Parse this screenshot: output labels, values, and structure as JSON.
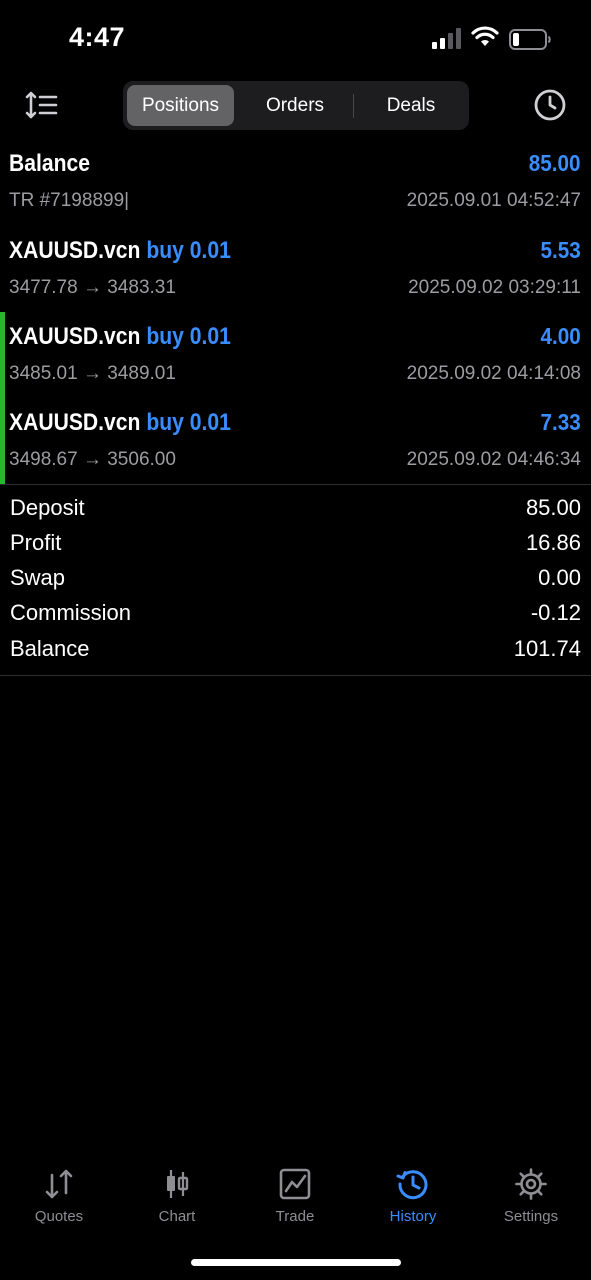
{
  "status_bar": {
    "time": "4:47"
  },
  "segments": [
    {
      "label": "Positions",
      "active": true
    },
    {
      "label": "Orders",
      "active": false
    },
    {
      "label": "Deals",
      "active": false
    }
  ],
  "balance_row": {
    "title": "Balance",
    "amount": "85.00",
    "sub": "TR #7198899|",
    "time": "2025.09.01 04:52:47"
  },
  "deals": [
    {
      "symbol": "XAUUSD.vcn",
      "side": "buy 0.01",
      "profit": "5.53",
      "prices": "3477.78 → 3483.31",
      "time": "2025.09.02 03:29:11"
    },
    {
      "symbol": "XAUUSD.vcn",
      "side": "buy 0.01",
      "profit": "4.00",
      "prices": "3485.01 → 3489.01",
      "time": "2025.09.02 04:14:08"
    },
    {
      "symbol": "XAUUSD.vcn",
      "side": "buy 0.01",
      "profit": "7.33",
      "prices": "3498.67 → 3506.00",
      "time": "2025.09.02 04:46:34"
    }
  ],
  "summary": [
    {
      "label": "Deposit",
      "value": "85.00"
    },
    {
      "label": "Profit",
      "value": "16.86"
    },
    {
      "label": "Swap",
      "value": "0.00"
    },
    {
      "label": "Commission",
      "value": "-0.12"
    },
    {
      "label": "Balance",
      "value": "101.74"
    }
  ],
  "tabs": [
    {
      "label": "Quotes",
      "icon": "quotes-icon"
    },
    {
      "label": "Chart",
      "icon": "chart-icon"
    },
    {
      "label": "Trade",
      "icon": "trade-icon"
    },
    {
      "label": "History",
      "icon": "history-icon",
      "active": true
    },
    {
      "label": "Settings",
      "icon": "gear-icon"
    }
  ],
  "colors": {
    "accent": "#3a8dff",
    "positive_bar": "#2bb52f",
    "muted": "#9c9ca1"
  }
}
